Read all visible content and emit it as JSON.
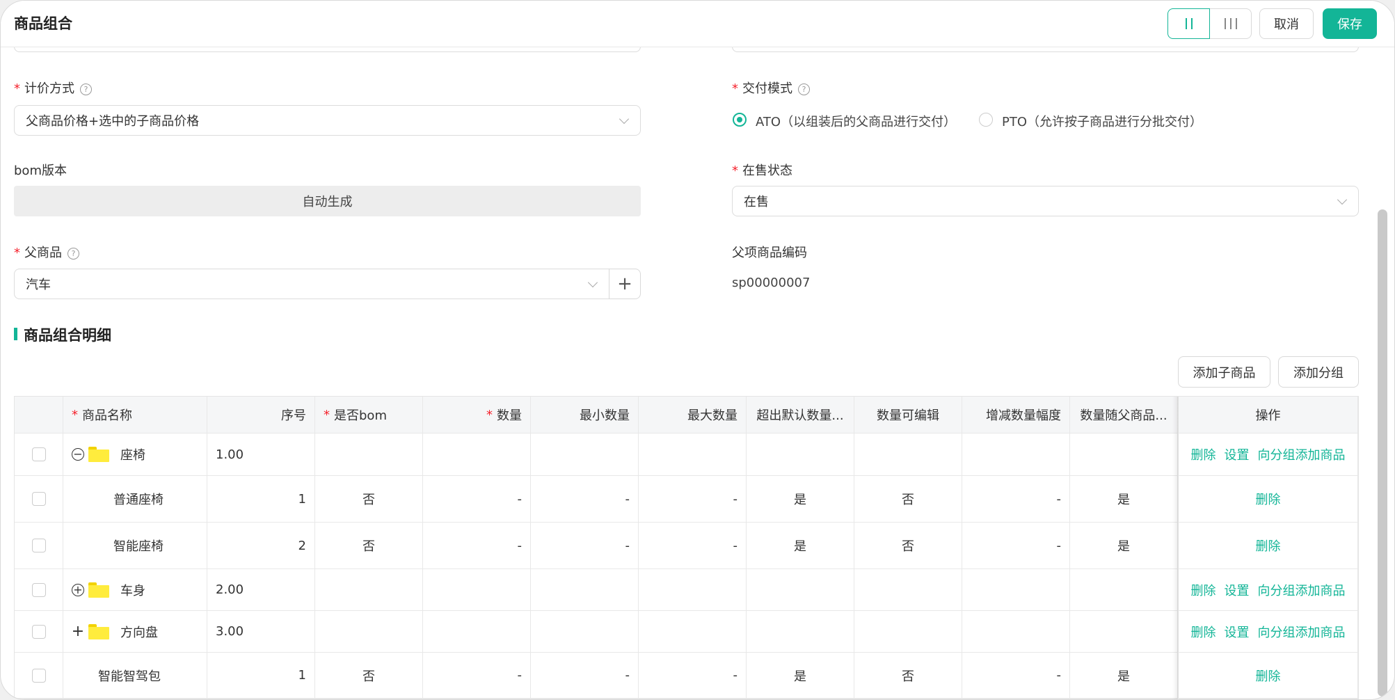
{
  "header": {
    "title": "商品组合",
    "layout_two_col": "II",
    "layout_three_col": "III",
    "cancel_label": "取消",
    "save_label": "保存"
  },
  "form": {
    "pricing": {
      "label": "计价方式",
      "value": "父商品价格+选中的子商品价格"
    },
    "delivery": {
      "label": "交付模式",
      "options": [
        {
          "label": "ATO（以组装后的父商品进行交付）",
          "selected": true
        },
        {
          "label": "PTO（允许按子商品进行分批交付）",
          "selected": false
        }
      ]
    },
    "bom_version": {
      "label": "bom版本",
      "value": "自动生成"
    },
    "sale_status": {
      "label": "在售状态",
      "value": "在售"
    },
    "parent_product": {
      "label": "父商品",
      "value": "汽车"
    },
    "parent_code": {
      "label": "父项商品编码",
      "value": "sp00000007"
    }
  },
  "section": {
    "title": "商品组合明细",
    "add_child_label": "添加子商品",
    "add_group_label": "添加分组"
  },
  "table": {
    "columns": [
      {
        "label": "商品名称",
        "required": true
      },
      {
        "label": "序号",
        "required": false
      },
      {
        "label": "是否bom",
        "required": true
      },
      {
        "label": "数量",
        "required": true
      },
      {
        "label": "最小数量",
        "required": false
      },
      {
        "label": "最大数量",
        "required": false
      },
      {
        "label": "超出默认数量...",
        "required": false
      },
      {
        "label": "数量可编辑",
        "required": false
      },
      {
        "label": "增减数量幅度",
        "required": false
      },
      {
        "label": "数量随父商品...",
        "required": false
      },
      {
        "label": "操作",
        "required": false
      }
    ],
    "rows": [
      {
        "type": "group",
        "toggle": "−",
        "name": "座椅",
        "seq": "1.00",
        "ops": [
          "删除",
          "设置",
          "向分组添加商品"
        ]
      },
      {
        "type": "item",
        "name": "普通座椅",
        "seq": "1",
        "is_bom": "否",
        "qty": "-",
        "min": "-",
        "max": "-",
        "over": "是",
        "editable": "否",
        "step": "-",
        "follow": "是",
        "ops": [
          "删除"
        ]
      },
      {
        "type": "item",
        "name": "智能座椅",
        "seq": "2",
        "is_bom": "否",
        "qty": "-",
        "min": "-",
        "max": "-",
        "over": "是",
        "editable": "否",
        "step": "-",
        "follow": "是",
        "ops": [
          "删除"
        ]
      },
      {
        "type": "group",
        "toggle": "+",
        "name": "车身",
        "seq": "2.00",
        "ops": [
          "删除",
          "设置",
          "向分组添加商品"
        ]
      },
      {
        "type": "group",
        "toggle": "+",
        "name": "方向盘",
        "seq": "3.00",
        "ops": [
          "删除",
          "设置",
          "向分组添加商品"
        ]
      },
      {
        "type": "item",
        "name": "智能智驾包",
        "seq": "1",
        "is_bom": "否",
        "qty": "-",
        "min": "-",
        "max": "-",
        "over": "是",
        "editable": "否",
        "step": "-",
        "follow": "是",
        "ops": [
          "删除"
        ]
      }
    ]
  }
}
